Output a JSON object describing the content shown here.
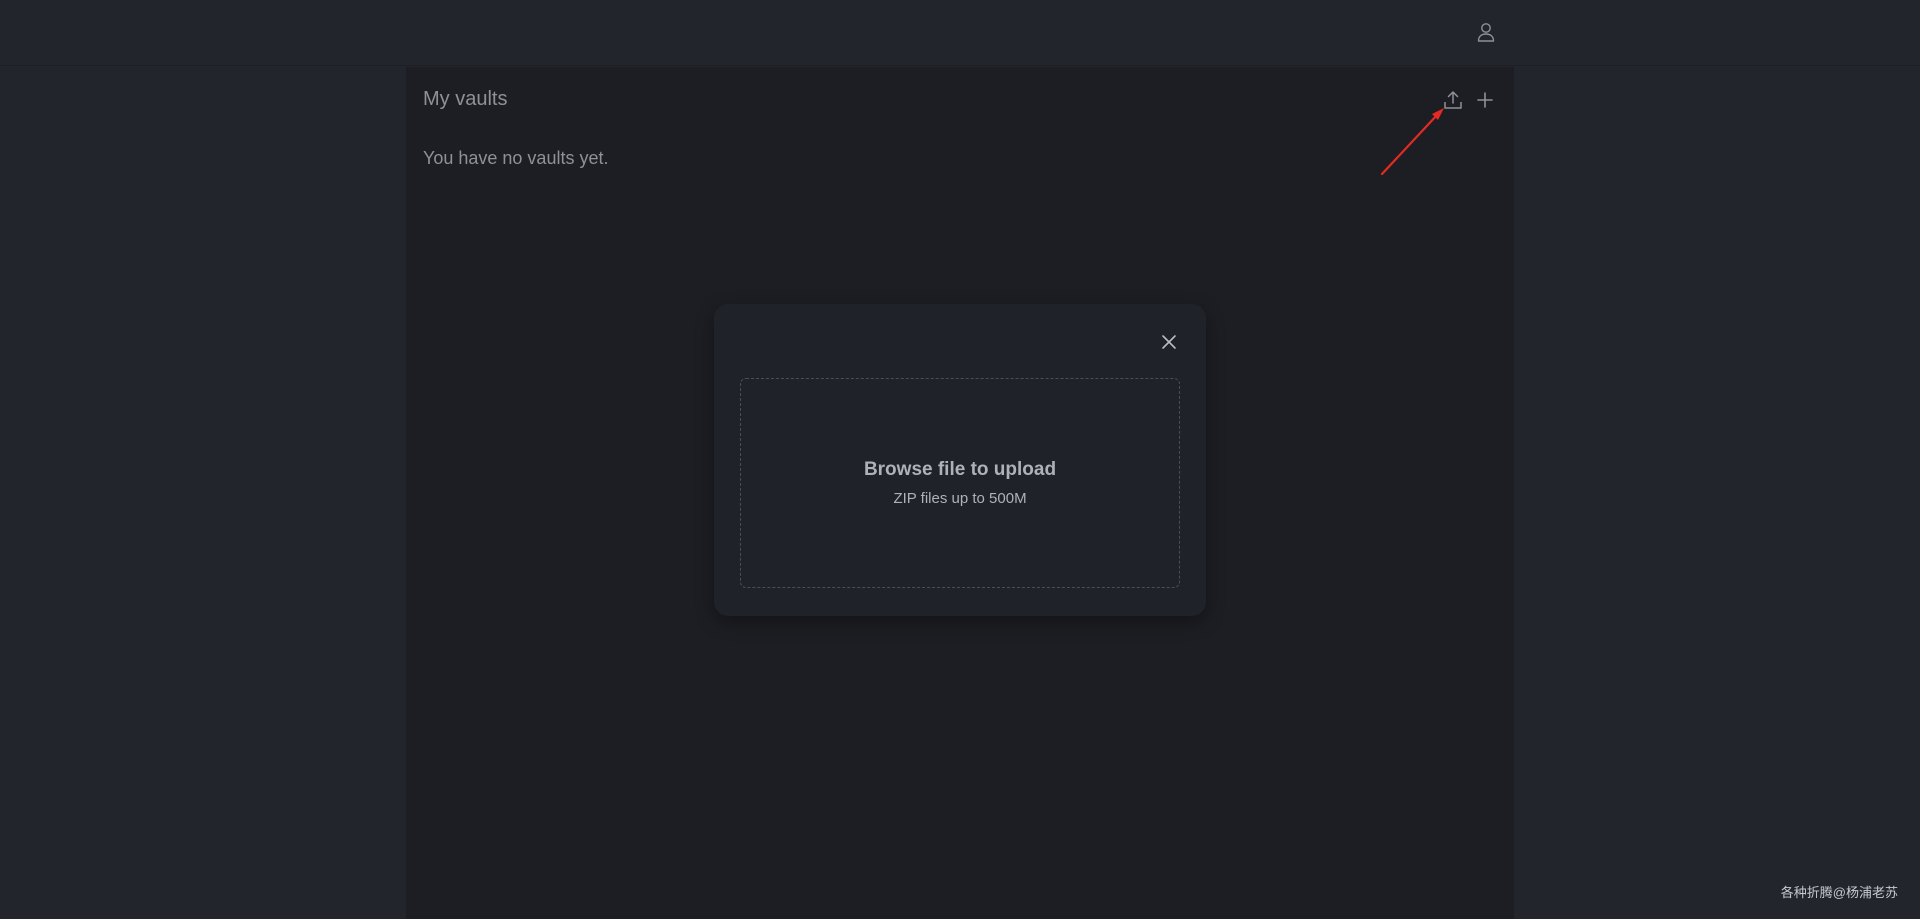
{
  "header": {
    "user_icon": "user-icon"
  },
  "main": {
    "title": "My vaults",
    "empty_message": "You have no vaults yet.",
    "upload_icon": "upload-icon",
    "add_icon": "plus-icon"
  },
  "upload_modal": {
    "close_icon": "close-icon",
    "dropzone_title": "Browse file to upload",
    "dropzone_subtitle": "ZIP files up to 500M"
  },
  "watermark": "各种折腾@杨浦老苏",
  "colors": {
    "background": "#22252c",
    "panel": "#1c1e23",
    "modal": "#1f2229",
    "text_muted": "#8e9197",
    "annotation": "#e52a22"
  }
}
